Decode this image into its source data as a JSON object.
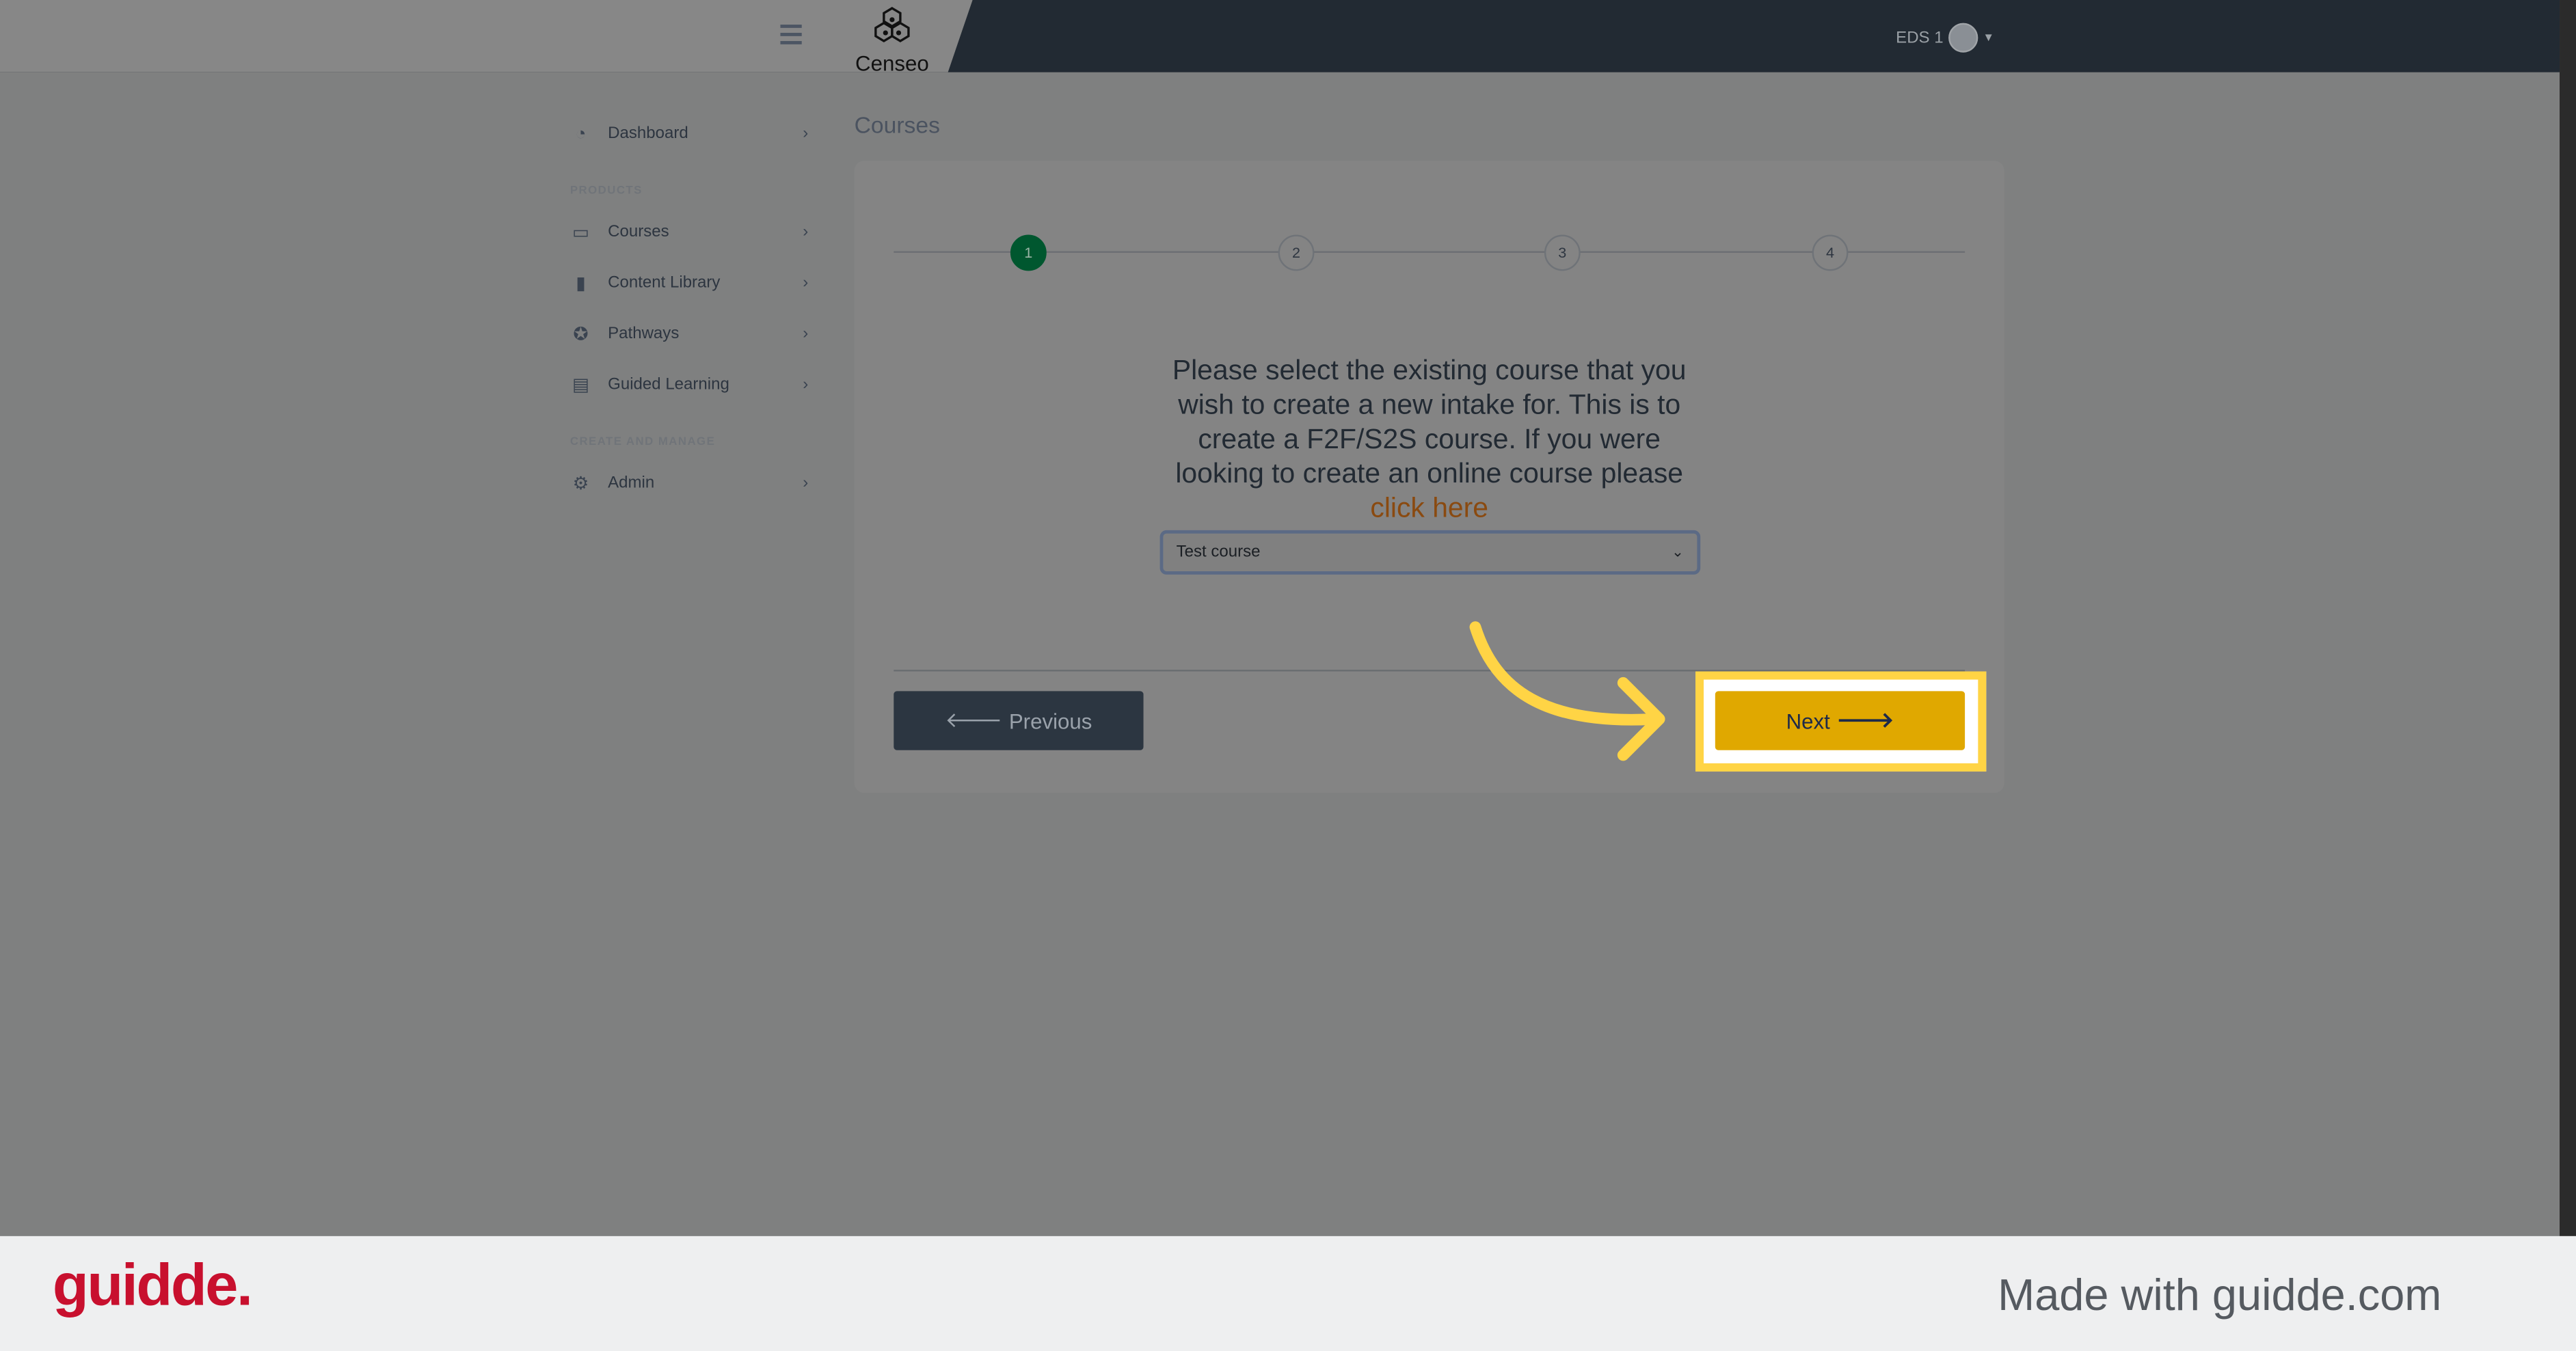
{
  "header": {
    "brand": "Censeo",
    "user_label": "EDS 1",
    "colors": {
      "bar": "#222a33"
    }
  },
  "sidebar": {
    "items": [
      {
        "label": "Dashboard",
        "icon": "dashboard-gauge-icon"
      },
      {
        "section": "PRODUCTS"
      },
      {
        "label": "Courses",
        "icon": "chalkboard-teacher-icon"
      },
      {
        "label": "Content Library",
        "icon": "book-icon"
      },
      {
        "label": "Pathways",
        "icon": "award-ribbon-icon"
      },
      {
        "label": "Guided Learning",
        "icon": "clipboard-list-icon"
      },
      {
        "section": "CREATE AND MANAGE"
      },
      {
        "label": "Admin",
        "icon": "gear-icon"
      }
    ]
  },
  "main": {
    "title": "Courses",
    "steps": [
      "1",
      "2",
      "3",
      "4"
    ],
    "active_step": 1,
    "instruction": "Please select the existing course that you wish to create a new intake for. This is to create a F2F/S2S course. If you were looking to create an online course please",
    "link_text": "click here",
    "course_select": {
      "value": "Test course"
    },
    "previous_label": "Previous",
    "next_label": "Next",
    "colors": {
      "active_step": "#00572f",
      "next": "#e0a800",
      "link": "#8a4a10",
      "highlight": "#ffd445"
    }
  },
  "footer": {
    "logo": "guidde.",
    "made_with": "Made with guidde.com"
  }
}
